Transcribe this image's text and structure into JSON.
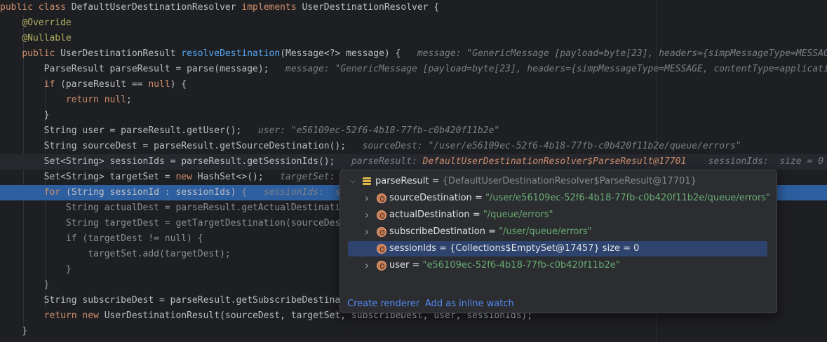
{
  "code_lines": [
    {
      "segments": [
        [
          "kw",
          "public class "
        ],
        [
          "",
          "DefaultUserDestinationResolver "
        ],
        [
          "kw",
          "implements "
        ],
        [
          "",
          "UserDestinationResolver {"
        ]
      ]
    },
    {
      "segments": [
        [
          "",
          "    "
        ],
        [
          "ann",
          "@Override"
        ]
      ]
    },
    {
      "segments": [
        [
          "",
          "    "
        ],
        [
          "ann",
          "@Nullable"
        ]
      ]
    },
    {
      "segments": [
        [
          "",
          "    "
        ],
        [
          "kw",
          "public "
        ],
        [
          "",
          "UserDestinationResult "
        ],
        [
          "fn",
          "resolveDestination"
        ],
        [
          "",
          "(Message<?> message) {   "
        ],
        [
          "hint",
          "message: \"GenericMessage [payload=byte[23], headers={simpMessageType=MESSAGE"
        ]
      ]
    },
    {
      "segments": [
        [
          "",
          "        ParseResult parseResult = parse(message);   "
        ],
        [
          "hint",
          "message: \"GenericMessage [payload=byte[23], headers={simpMessageType=MESSAGE, contentType=applicatio"
        ]
      ]
    },
    {
      "segments": [
        [
          "",
          "        "
        ],
        [
          "kw",
          "if "
        ],
        [
          "",
          "(parseResult == "
        ],
        [
          "kw",
          "null"
        ],
        [
          "",
          ") {"
        ]
      ]
    },
    {
      "segments": [
        [
          "",
          "            "
        ],
        [
          "kw",
          "return null"
        ],
        [
          "",
          ";"
        ]
      ]
    },
    {
      "segments": [
        [
          "",
          "        }"
        ]
      ]
    },
    {
      "segments": [
        [
          "",
          "        String user = parseResult.getUser();   "
        ],
        [
          "hint",
          "user: \"e56109ec-52f6-4b18-77fb-c0b420f11b2e\""
        ]
      ]
    },
    {
      "segments": [
        [
          "",
          "        String sourceDest = parseResult.getSourceDestination();   "
        ],
        [
          "hint",
          "sourceDest: \"/user/e56109ec-52f6-4b18-77fb-c0b420f11b2e/queue/errors\""
        ]
      ]
    },
    {
      "segments": [
        [
          "",
          "        Set<String> sessionIds = parseResult.getSessionIds();   "
        ],
        [
          "hint",
          "parseResult: "
        ],
        [
          "hintorange",
          "DefaultUserDestinationResolver$ParseResult@17701"
        ],
        [
          "hint",
          "    sessionIds:  size = 0"
        ]
      ]
    },
    {
      "segments": [
        [
          "",
          "        Set<String> targetSet = "
        ],
        [
          "kw",
          "new "
        ],
        [
          "",
          "HashSet<>();   "
        ],
        [
          "hint",
          "targetSet: "
        ]
      ]
    },
    {
      "segments": [
        [
          "",
          "        "
        ],
        [
          "kw",
          "for "
        ],
        [
          "",
          "(String sessionId : sessionIds) "
        ],
        [
          "dim",
          "{   "
        ],
        [
          "hint",
          "sessionIds:  si"
        ]
      ]
    },
    {
      "segments": [
        [
          "dim",
          "            String actualDest = parseResult.getActualDestinati"
        ]
      ]
    },
    {
      "segments": [
        [
          "dim",
          "            String targetDest = getTargetDestination(sourceDes"
        ]
      ]
    },
    {
      "segments": [
        [
          "dim",
          "            if (targetDest != null) {"
        ]
      ]
    },
    {
      "segments": [
        [
          "dim",
          "                targetSet.add(targetDest);"
        ]
      ]
    },
    {
      "segments": [
        [
          "dim",
          "            }"
        ]
      ]
    },
    {
      "segments": [
        [
          "dim",
          "        }"
        ]
      ]
    },
    {
      "segments": [
        [
          "",
          "        String subscribeDest = parseResult.getSubscribeDestina"
        ]
      ]
    },
    {
      "segments": [
        [
          "",
          "        "
        ],
        [
          "kw",
          "return new "
        ],
        [
          "",
          "UserDestinationResult(sourceDest, targetSet, subscribeDest, user, sessionIds);"
        ]
      ]
    },
    {
      "segments": [
        [
          "",
          "    }"
        ]
      ]
    }
  ],
  "popup": {
    "root": {
      "name": "parseResult",
      "eq": " = ",
      "ref": "{DefaultUserDestinationResolver$ParseResult@17701}"
    },
    "fields": [
      {
        "name": "sourceDestination",
        "eq": " = ",
        "value": "\"/user/e56109ec-52f6-4b18-77fb-c0b420f11b2e/queue/errors\"",
        "expandable": true,
        "selected": false
      },
      {
        "name": "actualDestination",
        "eq": " = ",
        "value": "\"/queue/errors\"",
        "expandable": true,
        "selected": false
      },
      {
        "name": "subscribeDestination",
        "eq": " = ",
        "value": "\"/user/queue/errors\"",
        "expandable": true,
        "selected": false
      },
      {
        "name": "sessionIds",
        "eq": " = ",
        "value": "{Collections$EmptySet@17457}  size = 0",
        "expandable": false,
        "selected": true
      },
      {
        "name": "user",
        "eq": " = ",
        "value": "\"e56109ec-52f6-4b18-77fb-c0b420f11b2e\"",
        "expandable": true,
        "selected": false
      }
    ],
    "create_renderer": "Create renderer",
    "add_inline_watch": "Add as inline watch"
  },
  "colors": {
    "background": "#1e1f22",
    "execution_line": "#2d5fa0",
    "keyword": "#cf8e6d",
    "annotation": "#b3ae60",
    "method": "#56a8f5",
    "string_value": "#6aab73",
    "link": "#548af7"
  },
  "icons": [
    "chevron-down-icon",
    "chevron-right-icon",
    "stack-frame-icon",
    "field-icon"
  ]
}
